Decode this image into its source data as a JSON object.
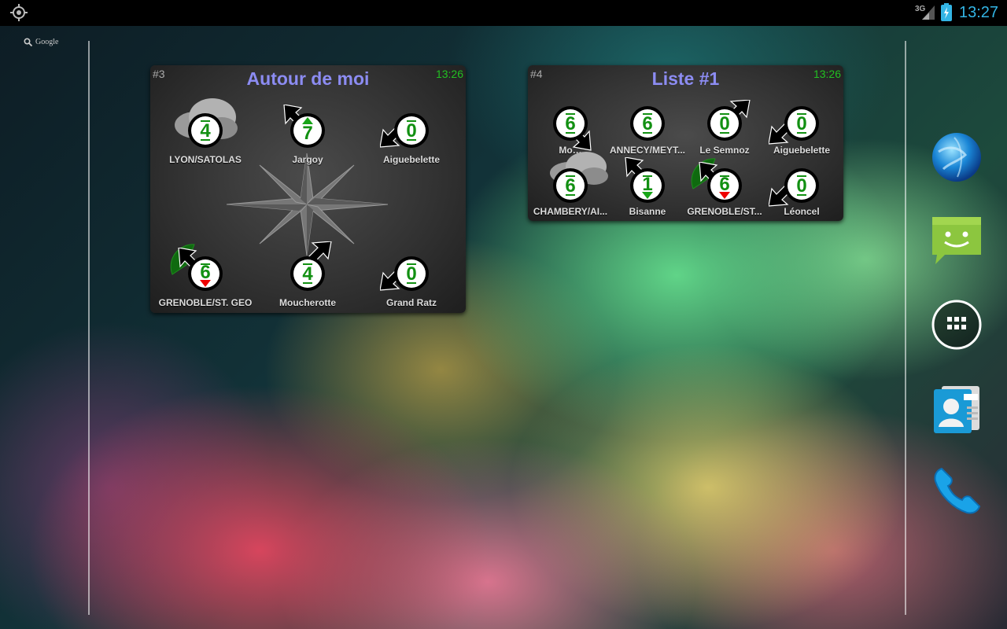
{
  "statusbar": {
    "network": "3G",
    "time": "13:27"
  },
  "google_search": {
    "label": "Google"
  },
  "widget1": {
    "number": "#3",
    "title": "Autour de moi",
    "time": "13:26",
    "stations": [
      {
        "name": "LYON/SATOLAS",
        "value": "4",
        "trend": "steady"
      },
      {
        "name": "Jargoy",
        "value": "7",
        "trend": "up"
      },
      {
        "name": "Aiguebelette",
        "value": "0",
        "trend": "steady"
      },
      {
        "name": "GRENOBLE/ST. GEO",
        "value": "6",
        "trend": "down"
      },
      {
        "name": "Moucherotte",
        "value": "4",
        "trend": "steady"
      },
      {
        "name": "Grand Ratz",
        "value": "0",
        "trend": "steady"
      }
    ]
  },
  "widget2": {
    "number": "#4",
    "title": "Liste #1",
    "time": "13:26",
    "stations": [
      {
        "name": "Mo…",
        "value": "6",
        "trend": "steady"
      },
      {
        "name": "ANNECY/MEYT...",
        "value": "6",
        "trend": "steady"
      },
      {
        "name": "Le Semnoz",
        "value": "0",
        "trend": "steady"
      },
      {
        "name": "Aiguebelette",
        "value": "0",
        "trend": "steady"
      },
      {
        "name": "CHAMBERY/AI...",
        "value": "6",
        "trend": "steady"
      },
      {
        "name": "Bisanne",
        "value": "1",
        "trend": "down-green"
      },
      {
        "name": "GRENOBLE/ST...",
        "value": "6",
        "trend": "down"
      },
      {
        "name": "Léoncel",
        "value": "0",
        "trend": "steady"
      }
    ]
  },
  "dock": [
    "browser-globe-icon",
    "messaging-icon",
    "app-drawer-icon",
    "contacts-icon",
    "phone-icon"
  ],
  "colors": {
    "accent": "#33b5e5",
    "title": "#8c8cf2",
    "wind_value": "#129012",
    "time_green": "#22c022"
  }
}
